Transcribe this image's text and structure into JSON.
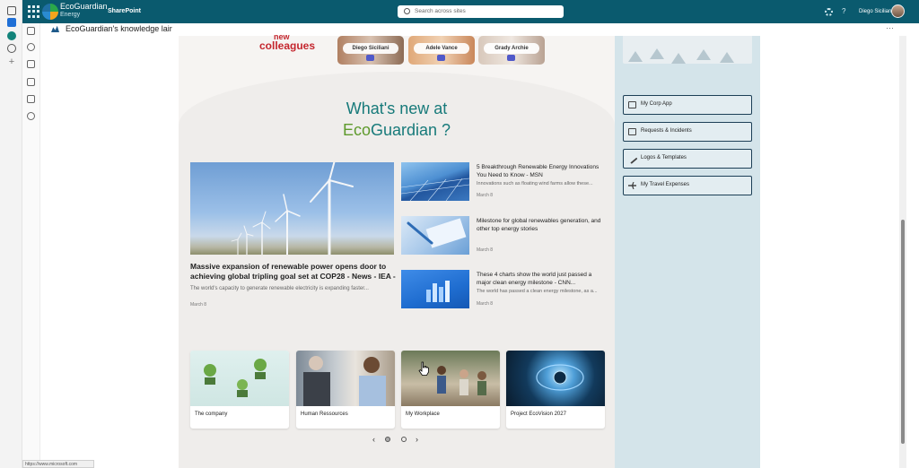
{
  "header": {
    "brand_line1": "EcoGuardian",
    "brand_line2": "Energy",
    "app": "SharePoint",
    "search_placeholder": "Search across sites",
    "user_name": "Diego Siciliani"
  },
  "site": {
    "title": "EcoGuardian's knowledge lair"
  },
  "colleagues": {
    "heading_part": "new",
    "heading": "colleagues",
    "people": [
      "Diego Siciliani",
      "Adele Vance",
      "Grady Archie"
    ]
  },
  "news": {
    "heading_line1": "What's new at",
    "heading_eco": "Eco",
    "heading_guardian": "Guardian ?",
    "hero": {
      "title": "Massive expansion of renewable power opens door to achieving global tripling goal set at COP28 - News - IEA -",
      "desc": "The world's capacity to generate renewable electricity is expanding faster...",
      "date": "March 8"
    },
    "items": [
      {
        "title": "5 Breakthrough Renewable Energy Innovations You Need to Know - MSN",
        "desc": "Innovations such as floating wind farms allow these...",
        "date": "March 8"
      },
      {
        "title": "Milestone for global renewables generation, and other top energy stories",
        "desc": "",
        "date": "March 8"
      },
      {
        "title": "These 4 charts show the world just passed a major clean energy milestone - CNN...",
        "desc": "The world has passed a clean energy milestone, as a...",
        "date": "March 8"
      }
    ]
  },
  "quick_links": [
    "My Corp App",
    "Requests & Incidents",
    "Logos & Templates",
    "My Travel Expenses"
  ],
  "tiles": [
    "The company",
    "Human Ressources",
    "My Workplace",
    "Project EcoVision 2027"
  ],
  "pager": {
    "prev": "‹",
    "next": "›"
  },
  "status_url": "https://www.microsoft.com",
  "colors": {
    "header": "#0a5a6e",
    "accent_teal": "#177a7a",
    "accent_green": "#5e9a2c",
    "accent_red": "#c4262e",
    "panel": "#d4e4ea"
  }
}
